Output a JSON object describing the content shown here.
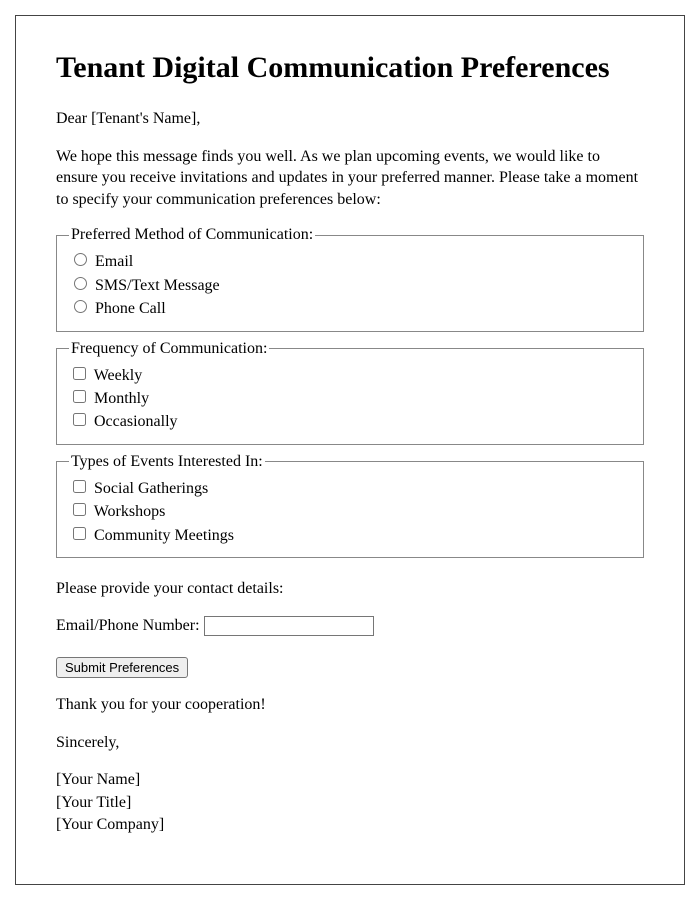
{
  "title": "Tenant Digital Communication Preferences",
  "greeting": "Dear [Tenant's Name],",
  "intro": "We hope this message finds you well. As we plan upcoming events, we would like to ensure you receive invitations and updates in your preferred manner. Please take a moment to specify your communication preferences below:",
  "fieldsets": {
    "method": {
      "legend": "Preferred Method of Communication:",
      "options": [
        "Email",
        "SMS/Text Message",
        "Phone Call"
      ]
    },
    "frequency": {
      "legend": "Frequency of Communication:",
      "options": [
        "Weekly",
        "Monthly",
        "Occasionally"
      ]
    },
    "events": {
      "legend": "Types of Events Interested In:",
      "options": [
        "Social Gatherings",
        "Workshops",
        "Community Meetings"
      ]
    }
  },
  "contact_prompt": "Please provide your contact details:",
  "contact_label": "Email/Phone Number: ",
  "submit_label": "Submit Preferences",
  "thanks": "Thank you for your cooperation!",
  "closing": "Sincerely,",
  "signature": {
    "name": "[Your Name]",
    "title": "[Your Title]",
    "company": "[Your Company]"
  }
}
